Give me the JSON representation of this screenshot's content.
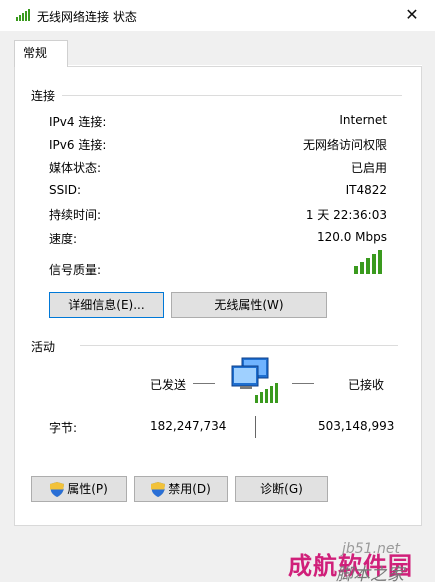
{
  "window": {
    "title": "无线网络连接 状态",
    "close_glyph": "✕"
  },
  "tabs": [
    {
      "label": "常规"
    }
  ],
  "connection": {
    "section_title": "连接",
    "rows": [
      {
        "label": "IPv4 连接:",
        "value": "Internet"
      },
      {
        "label": "IPv6 连接:",
        "value": "无网络访问权限"
      },
      {
        "label": "媒体状态:",
        "value": "已启用"
      },
      {
        "label": "SSID:",
        "value": "IT4822"
      },
      {
        "label": "持续时间:",
        "value": "1 天 22:36:03"
      },
      {
        "label": "速度:",
        "value": "120.0 Mbps"
      }
    ],
    "signal_label": "信号质量:",
    "signal_bars_lit": 5,
    "signal_bars_total": 5
  },
  "buttons_mid": {
    "details": "详细信息(E)...",
    "wireless_props": "无线属性(W)"
  },
  "activity": {
    "section_title": "活动",
    "sent_label": "已发送",
    "received_label": "已接收",
    "bytes_label": "字节:",
    "bytes_sent": "182,247,734",
    "bytes_received": "503,148,993"
  },
  "buttons_bottom": {
    "properties": "属性(P)",
    "disable": "禁用(D)",
    "diagnose": "诊断(G)"
  },
  "icons": {
    "title": "wifi-signal-icon",
    "shield": "uac-shield-icon",
    "network": "network-computers-icon"
  },
  "watermark": {
    "line1": "jb51.net",
    "line2": "成航软件园",
    "line3": "脚本之家"
  },
  "colors": {
    "accent": "#0078d7",
    "signal_green": "#3a9a1e",
    "watermark_red": "#d0207a"
  }
}
